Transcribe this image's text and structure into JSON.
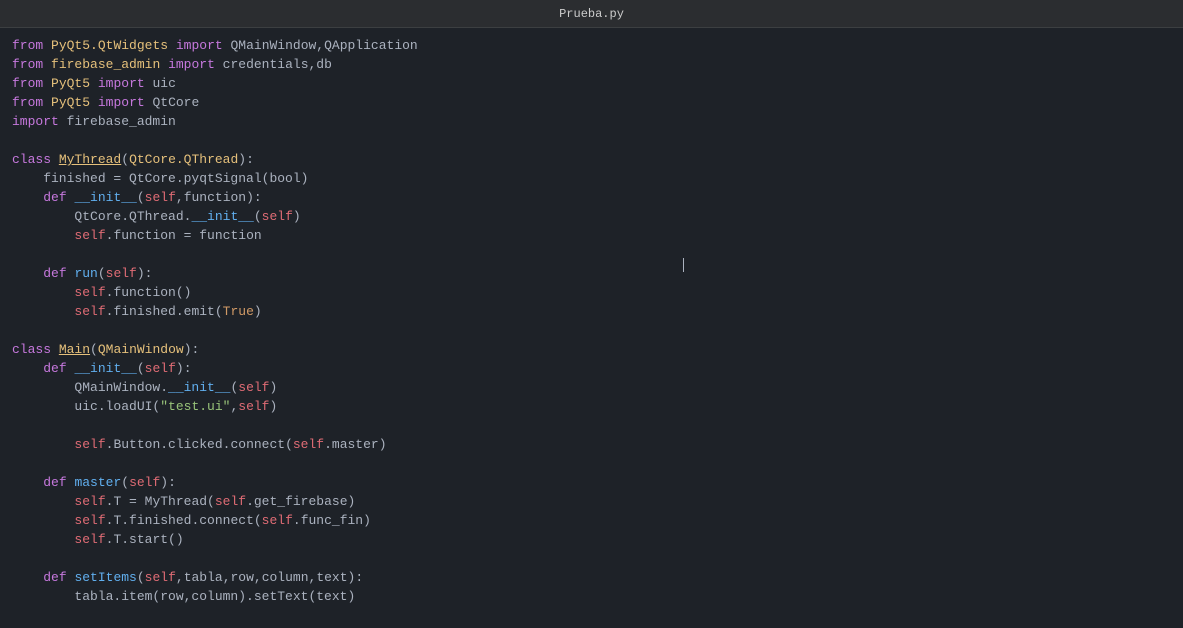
{
  "titleBar": {
    "filename": "Prueba.py"
  },
  "code": {
    "lines": [
      "from PyQt5.QtWidgets import QMainWindow,QApplication",
      "from firebase_admin import credentials,db",
      "from PyQt5 import uic",
      "from PyQt5 import QtCore",
      "import firebase_admin",
      "",
      "class MyThread(QtCore.QThread):",
      "    finished = QtCore.pyqtSignal(bool)",
      "    def __init__(self,function):",
      "        QtCore.QThread.__init__(self)",
      "        self.function = function",
      "",
      "    def run(self):",
      "        self.function()",
      "        self.finished.emit(True)",
      "",
      "class Main(QMainWindow):",
      "    def __init__(self):",
      "        QMainWindow.__init__(self)",
      "        uic.loadUI(\"test.ui\",self)",
      "",
      "        self.Button.clicked.connect(self.master)",
      "",
      "    def master(self):",
      "        self.T = MyThread(self.get_firebase)",
      "        self.T.finished.connect(self.func_fin)",
      "        self.T.start()",
      "",
      "    def setItems(self,tabla,row,column,text):",
      "        tabla.item(row,column).setText(text)"
    ]
  }
}
